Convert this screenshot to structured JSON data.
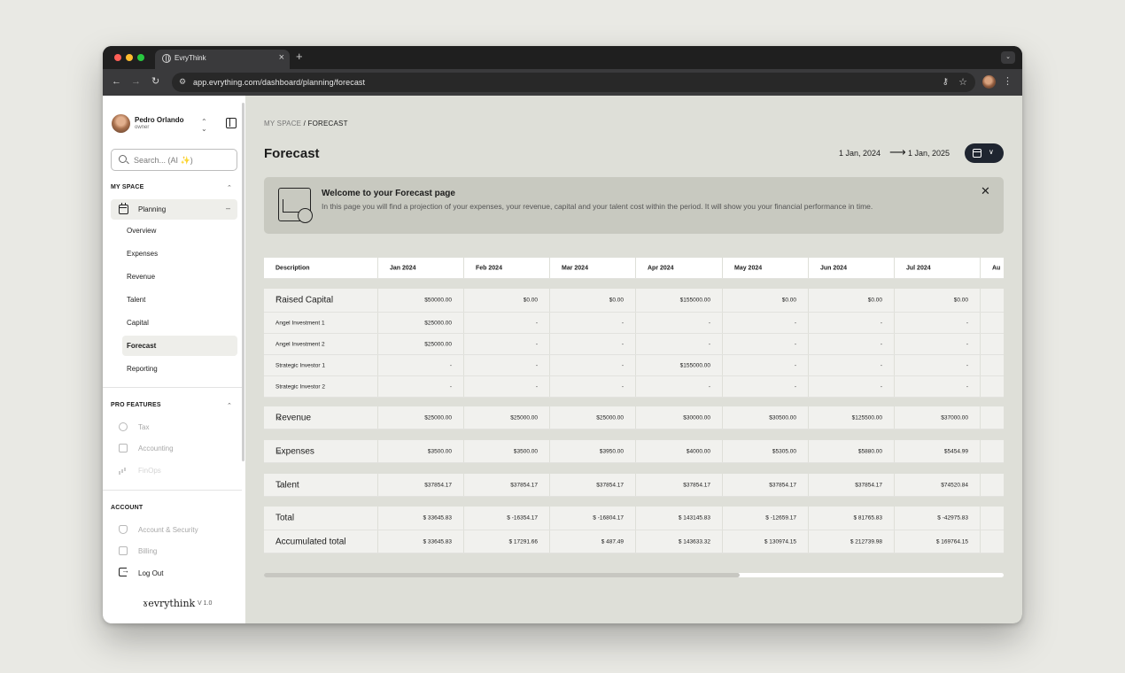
{
  "browser": {
    "tab_title": "EvryThink",
    "tab_close": "×",
    "new_tab": "+",
    "tab_menu": "⌄",
    "url": "app.evrything.com/dashboard/planning/forecast"
  },
  "user": {
    "name": "Pedro Orlando",
    "role": "owner"
  },
  "search": {
    "prefix": "Search... (AI ",
    "sparkle": "✨",
    "suffix": ")"
  },
  "sidebar": {
    "section_myspace": "MY SPACE",
    "planning_label": "Planning",
    "planning_items": [
      "Overview",
      "Expenses",
      "Revenue",
      "Talent",
      "Capital",
      "Forecast",
      "Reporting"
    ],
    "active_item": "Forecast",
    "section_pro": "PRO FEATURES",
    "pro_items": [
      "Tax",
      "Accounting",
      "FinOps"
    ],
    "section_account": "ACCOUNT",
    "account_items": [
      "Account & Security",
      "Billing"
    ],
    "logout": "Log Out",
    "logo": "evrythink",
    "version": "V 1.0"
  },
  "main": {
    "breadcrumb_parent": "MY SPACE",
    "breadcrumb_sep": " / ",
    "breadcrumb_current": "FORECAST",
    "title": "Forecast",
    "date_from": "1 Jan, 2024",
    "date_arrow": "⟶",
    "date_to": "1 Jan, 2025"
  },
  "banner": {
    "title": "Welcome to your Forecast page",
    "text": "In this page you will find a projection of your expenses, your revenue, capital and your talent cost within the period. It will show you your financial performance in time.",
    "close": "✕"
  },
  "table": {
    "header": [
      "Description",
      "Jan 2024",
      "Feb 2024",
      "Mar 2024",
      "Apr 2024",
      "May 2024",
      "Jun 2024",
      "Jul 2024",
      "Au"
    ],
    "raised_capital": {
      "label": "Raised Capital",
      "values": [
        "$50000.00",
        "$0.00",
        "$0.00",
        "$155000.00",
        "$0.00",
        "$0.00",
        "$0.00",
        ""
      ],
      "children": [
        {
          "label": "Angel Investment 1",
          "values": [
            "$25000.00",
            "-",
            "-",
            "-",
            "-",
            "-",
            "-",
            ""
          ]
        },
        {
          "label": "Angel Investment 2",
          "values": [
            "$25000.00",
            "-",
            "-",
            "-",
            "-",
            "-",
            "-",
            ""
          ]
        },
        {
          "label": "Strategic Investor 1",
          "values": [
            "-",
            "-",
            "-",
            "$155000.00",
            "-",
            "-",
            "-",
            ""
          ]
        },
        {
          "label": "Strategic Investor 2",
          "values": [
            "-",
            "-",
            "-",
            "-",
            "-",
            "-",
            "-",
            ""
          ]
        }
      ]
    },
    "revenue": {
      "label": "Revenue",
      "values": [
        "$25000.00",
        "$25000.00",
        "$25000.00",
        "$30000.00",
        "$30500.00",
        "$125500.00",
        "$37000.00",
        ""
      ]
    },
    "expenses": {
      "label": "Expenses",
      "values": [
        "$3500.00",
        "$3500.00",
        "$3950.00",
        "$4000.00",
        "$5305.00",
        "$5880.00",
        "$5454.99",
        ""
      ]
    },
    "talent": {
      "label": "Talent",
      "values": [
        "$37854.17",
        "$37854.17",
        "$37854.17",
        "$37854.17",
        "$37854.17",
        "$37854.17",
        "$74520.84",
        ""
      ]
    },
    "total": {
      "label": "Total",
      "values": [
        "$ 33645.83",
        "$ -16354.17",
        "$ -16804.17",
        "$ 143145.83",
        "$ -12659.17",
        "$ 81765.83",
        "$ -42975.83",
        ""
      ]
    },
    "accumulated": {
      "label": "Accumulated total",
      "values": [
        "$ 33645.83",
        "$ 17291.66",
        "$ 487.49",
        "$ 143633.32",
        "$ 130974.15",
        "$ 212739.98",
        "$ 169764.15",
        ""
      ]
    }
  }
}
